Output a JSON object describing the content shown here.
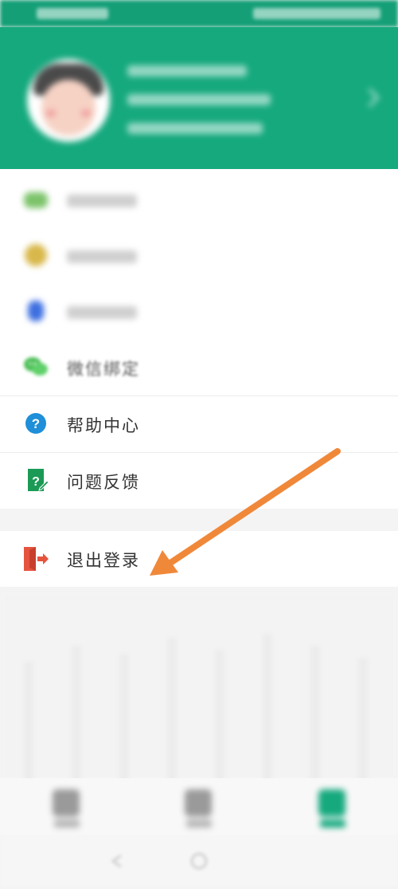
{
  "colors": {
    "header_green": "#16a97e",
    "help_blue": "#1e8fd8",
    "feedback_green": "#1a9a55",
    "logout_red": "#e5543e",
    "arrow_orange": "#f0883a"
  },
  "menu": {
    "wechat_label": "微信绑定",
    "help_label": "帮助中心",
    "feedback_label": "问题反馈"
  },
  "logout": {
    "label": "退出登录"
  },
  "icons": {
    "download": "download-icon",
    "favorite": "favorite-icon",
    "message": "bell-icon",
    "wechat": "wechat-icon",
    "help": "question-icon",
    "feedback": "feedback-icon",
    "logout": "logout-icon"
  }
}
